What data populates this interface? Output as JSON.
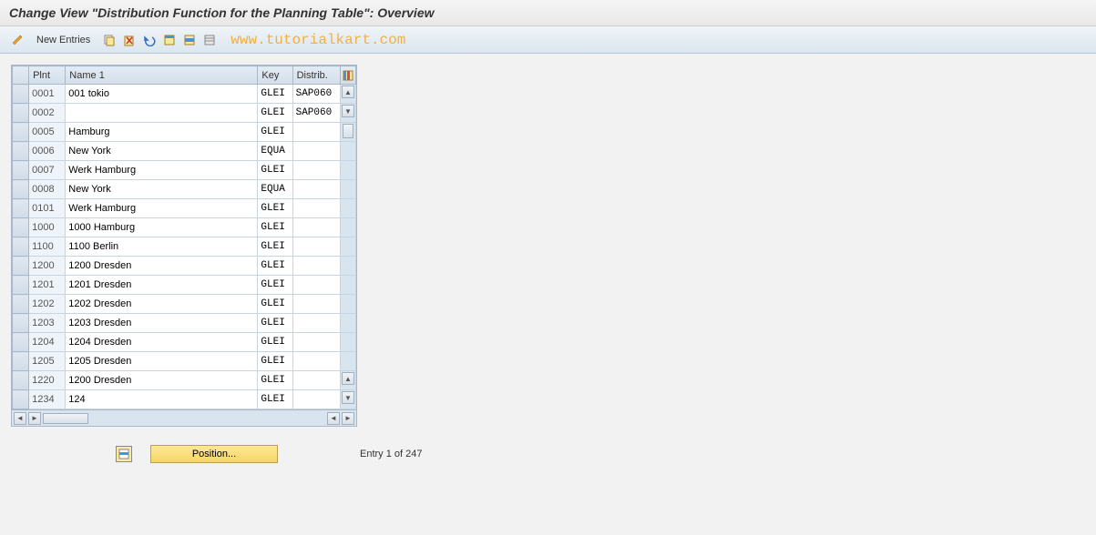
{
  "title": "Change View \"Distribution Function for the Planning Table\": Overview",
  "toolbar": {
    "new_entries_label": "New Entries"
  },
  "watermark": "www.tutorialkart.com",
  "table": {
    "headers": {
      "plnt": "Plnt",
      "name": "Name 1",
      "key": "Key",
      "distrib": "Distrib."
    },
    "rows": [
      {
        "plnt": "0001",
        "name": "001 tokio",
        "key": "GLEI",
        "distrib": "SAP060"
      },
      {
        "plnt": "0002",
        "name": "",
        "key": "GLEI",
        "distrib": "SAP060"
      },
      {
        "plnt": "0005",
        "name": "Hamburg",
        "key": "GLEI",
        "distrib": ""
      },
      {
        "plnt": "0006",
        "name": "New York",
        "key": "EQUA",
        "distrib": ""
      },
      {
        "plnt": "0007",
        "name": "Werk Hamburg",
        "key": "GLEI",
        "distrib": ""
      },
      {
        "plnt": "0008",
        "name": "New York",
        "key": "EQUA",
        "distrib": ""
      },
      {
        "plnt": "0101",
        "name": "Werk Hamburg",
        "key": "GLEI",
        "distrib": ""
      },
      {
        "plnt": "1000",
        "name": "1000 Hamburg",
        "key": "GLEI",
        "distrib": ""
      },
      {
        "plnt": "1100",
        "name": "1100 Berlin",
        "key": "GLEI",
        "distrib": ""
      },
      {
        "plnt": "1200",
        "name": "1200 Dresden",
        "key": "GLEI",
        "distrib": ""
      },
      {
        "plnt": "1201",
        "name": "1201 Dresden",
        "key": "GLEI",
        "distrib": ""
      },
      {
        "plnt": "1202",
        "name": "1202 Dresden",
        "key": "GLEI",
        "distrib": ""
      },
      {
        "plnt": "1203",
        "name": "1203 Dresden",
        "key": "GLEI",
        "distrib": ""
      },
      {
        "plnt": "1204",
        "name": "1204 Dresden",
        "key": "GLEI",
        "distrib": ""
      },
      {
        "plnt": "1205",
        "name": "1205 Dresden",
        "key": "GLEI",
        "distrib": ""
      },
      {
        "plnt": "1220",
        "name": "1200 Dresden",
        "key": "GLEI",
        "distrib": ""
      },
      {
        "plnt": "1234",
        "name": "124",
        "key": "GLEI",
        "distrib": ""
      }
    ]
  },
  "footer": {
    "position_label": "Position...",
    "entry_text": "Entry 1 of 247"
  }
}
